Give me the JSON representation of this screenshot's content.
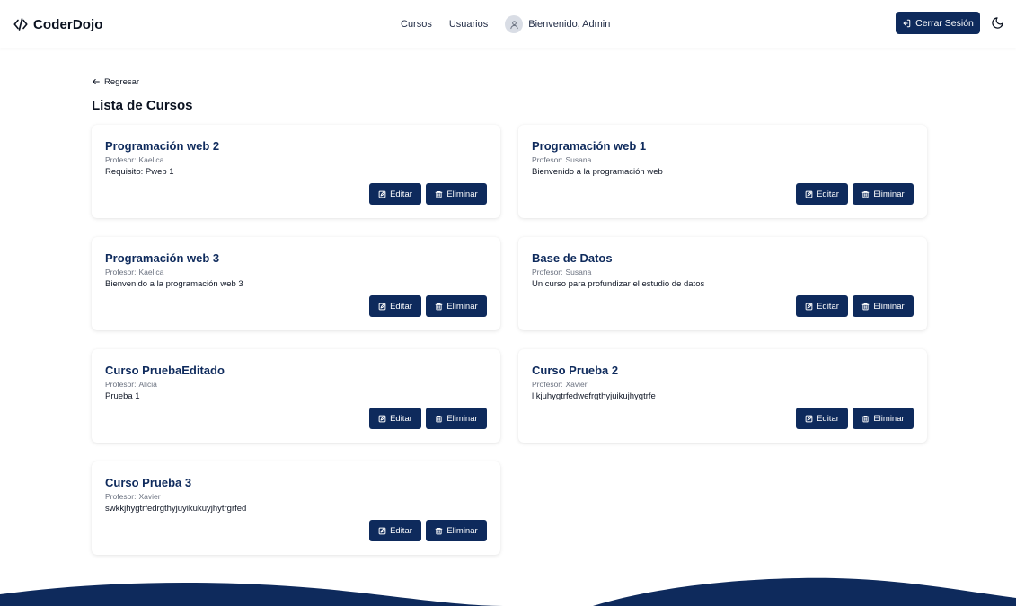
{
  "navbar": {
    "brand": "CoderDojo",
    "links": [
      "Cursos",
      "Usuarios"
    ],
    "welcome": "Bienvenido, Admin",
    "logout_label": "Cerrar Sesión"
  },
  "page": {
    "back_label": "Regresar",
    "title": "Lista de Cursos"
  },
  "card_labels": {
    "professor_prefix": "Profesor:",
    "edit": "Editar",
    "delete": "Eliminar"
  },
  "courses": [
    {
      "title": "Programación web 2",
      "professor": "Kaelica",
      "description": "Requisito: Pweb 1"
    },
    {
      "title": "Programación web 1",
      "professor": "Susana",
      "description": "Bienvenido a la programación web"
    },
    {
      "title": "Programación web 3",
      "professor": "Kaelica",
      "description": "Bienvenido a la programación web 3"
    },
    {
      "title": "Base de Datos",
      "professor": "Susana",
      "description": "Un curso para profundizar el estudio de datos"
    },
    {
      "title": "Curso PruebaEditado",
      "professor": "Alicia",
      "description": "Prueba 1"
    },
    {
      "title": "Curso Prueba 2",
      "professor": "Xavier",
      "description": "l,kjuhygtrfedwefrgthyjuikujhygtrfe"
    },
    {
      "title": "Curso Prueba 3",
      "professor": "Xavier",
      "description": "swkkjhygtrfedrgthyjuyikukuyjhytrgrfed"
    }
  ],
  "icons": {
    "brand": "code-icon",
    "avatar": "user-icon",
    "logout": "log-out-icon",
    "theme": "moon-icon",
    "back": "arrow-left-icon",
    "edit": "edit-icon",
    "delete": "trash-icon"
  },
  "colors": {
    "primary": "#0e2a5c",
    "background": "#ffffff",
    "muted_text": "#6b7280"
  }
}
